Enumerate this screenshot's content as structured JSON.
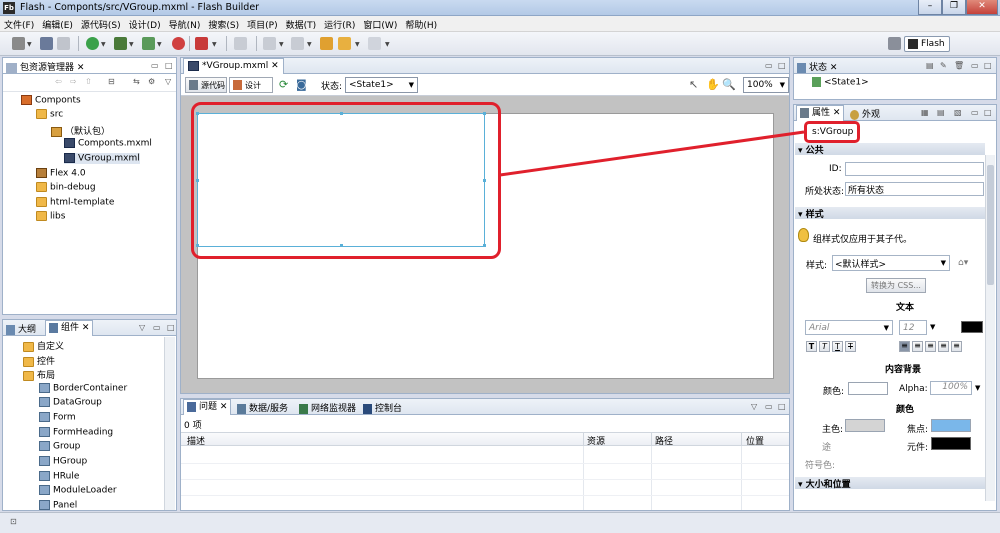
{
  "window": {
    "title": "Flash - Componts/src/VGroup.mxml - Flash Builder",
    "app_icon": "Fb"
  },
  "menu": [
    "文件(F)",
    "编辑(E)",
    "源代码(S)",
    "设计(D)",
    "导航(N)",
    "搜索(S)",
    "项目(P)",
    "数据(T)",
    "运行(R)",
    "窗口(W)",
    "帮助(H)"
  ],
  "perspective": {
    "label": "Flash"
  },
  "package_explorer": {
    "tab": "包资源管理器",
    "items": [
      {
        "label": "Componts",
        "icon": "project-icon"
      },
      {
        "label": "src",
        "icon": "folder-icon"
      },
      {
        "label": "（默认包）",
        "icon": "package-icon"
      },
      {
        "label": "Componts.mxml",
        "icon": "mxml-file-icon"
      },
      {
        "label": "VGroup.mxml",
        "icon": "mxml-file-icon"
      },
      {
        "label": "Flex 4.0",
        "icon": "library-icon"
      },
      {
        "label": "bin-debug",
        "icon": "folder-icon"
      },
      {
        "label": "html-template",
        "icon": "folder-icon"
      },
      {
        "label": "libs",
        "icon": "folder-icon"
      }
    ]
  },
  "outline": {
    "tab_outline": "大纲",
    "tab_components": "组件",
    "items": [
      {
        "label": "自定义",
        "icon": "folder-icon"
      },
      {
        "label": "控件",
        "icon": "folder-icon"
      },
      {
        "label": "布局",
        "icon": "folder-icon"
      },
      {
        "label": "BorderContainer",
        "icon": "component-icon"
      },
      {
        "label": "DataGroup",
        "icon": "component-icon"
      },
      {
        "label": "Form",
        "icon": "component-icon"
      },
      {
        "label": "FormHeading",
        "icon": "component-icon"
      },
      {
        "label": "Group",
        "icon": "component-icon"
      },
      {
        "label": "HGroup",
        "icon": "component-icon"
      },
      {
        "label": "HRule",
        "icon": "component-icon"
      },
      {
        "label": "ModuleLoader",
        "icon": "component-icon"
      },
      {
        "label": "Panel",
        "icon": "component-icon"
      }
    ]
  },
  "editor": {
    "tab": "*VGroup.mxml",
    "source_btn": "源代码",
    "design_btn": "设计",
    "state_label": "状态:",
    "state_value": "<State1>",
    "zoom": "100%"
  },
  "problems": {
    "tabs": [
      "问题",
      "数据/服务",
      "网络监视器",
      "控制台"
    ],
    "count": "0 项",
    "columns": [
      "描述",
      "资源",
      "路径",
      "位置"
    ]
  },
  "states": {
    "tab": "状态",
    "item": "<State1>"
  },
  "properties": {
    "tab": "属性",
    "tab2": "外观",
    "component": "s:VGroup",
    "common_header": "公共",
    "id_label": "ID:",
    "state_label": "所处状态:",
    "state_value": "所有状态",
    "style_header": "样式",
    "hint": "组样式仅应用于其子代。",
    "style_label": "样式:",
    "style_value": "<默认样式>",
    "convert_btn": "转换为 CSS...",
    "text_header": "文本",
    "font": "Arial",
    "font_size": "12",
    "bg_header": "内容背景",
    "color_label": "颜色:",
    "alpha_label": "Alpha:",
    "alpha_value": "100%",
    "color_header": "颜色",
    "main_color": "主色:",
    "focus_color": "焦点:",
    "roll_label": "途",
    "elem_color": "元件:",
    "symbol_label": "符号色:",
    "size_header": "大小和位置"
  },
  "colors": {
    "highlight": "#e0202c",
    "focus_swatch": "#7ab7ea"
  }
}
